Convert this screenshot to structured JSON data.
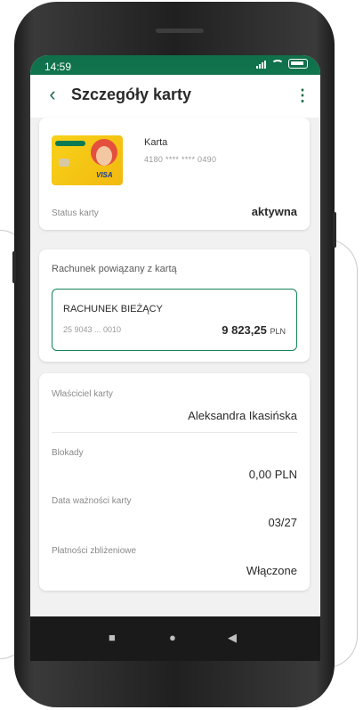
{
  "status_bar": {
    "time": "14:59"
  },
  "app_bar": {
    "back": "‹",
    "title": "Szczegóły karty",
    "menu": "⋮"
  },
  "card_section": {
    "card_name": "Karta",
    "card_number": "4180 **** **** 0490",
    "status_label": "Status karty",
    "status_value": "aktywna",
    "card_brand": "VISA"
  },
  "account_section": {
    "heading": "Rachunek powiązany z kartą",
    "account_name": "RACHUNEK BIEŻĄCY",
    "account_number": "25 9043 ... 0010",
    "balance": "9 823,25",
    "currency": "PLN"
  },
  "details": {
    "owner_label": "Właściciel karty",
    "owner_value": "Aleksandra Ikasińska",
    "blocks_label": "Blokady",
    "blocks_value": "0,00 PLN",
    "expiry_label": "Data ważności karty",
    "expiry_value": "03/27",
    "contactless_label": "Płatności zbliżeniowe",
    "contactless_value": "Włączone"
  },
  "nav": {
    "recent": "■",
    "home": "●",
    "back": "◀"
  },
  "colors": {
    "primary": "#138456",
    "accent": "#1c6a47"
  }
}
